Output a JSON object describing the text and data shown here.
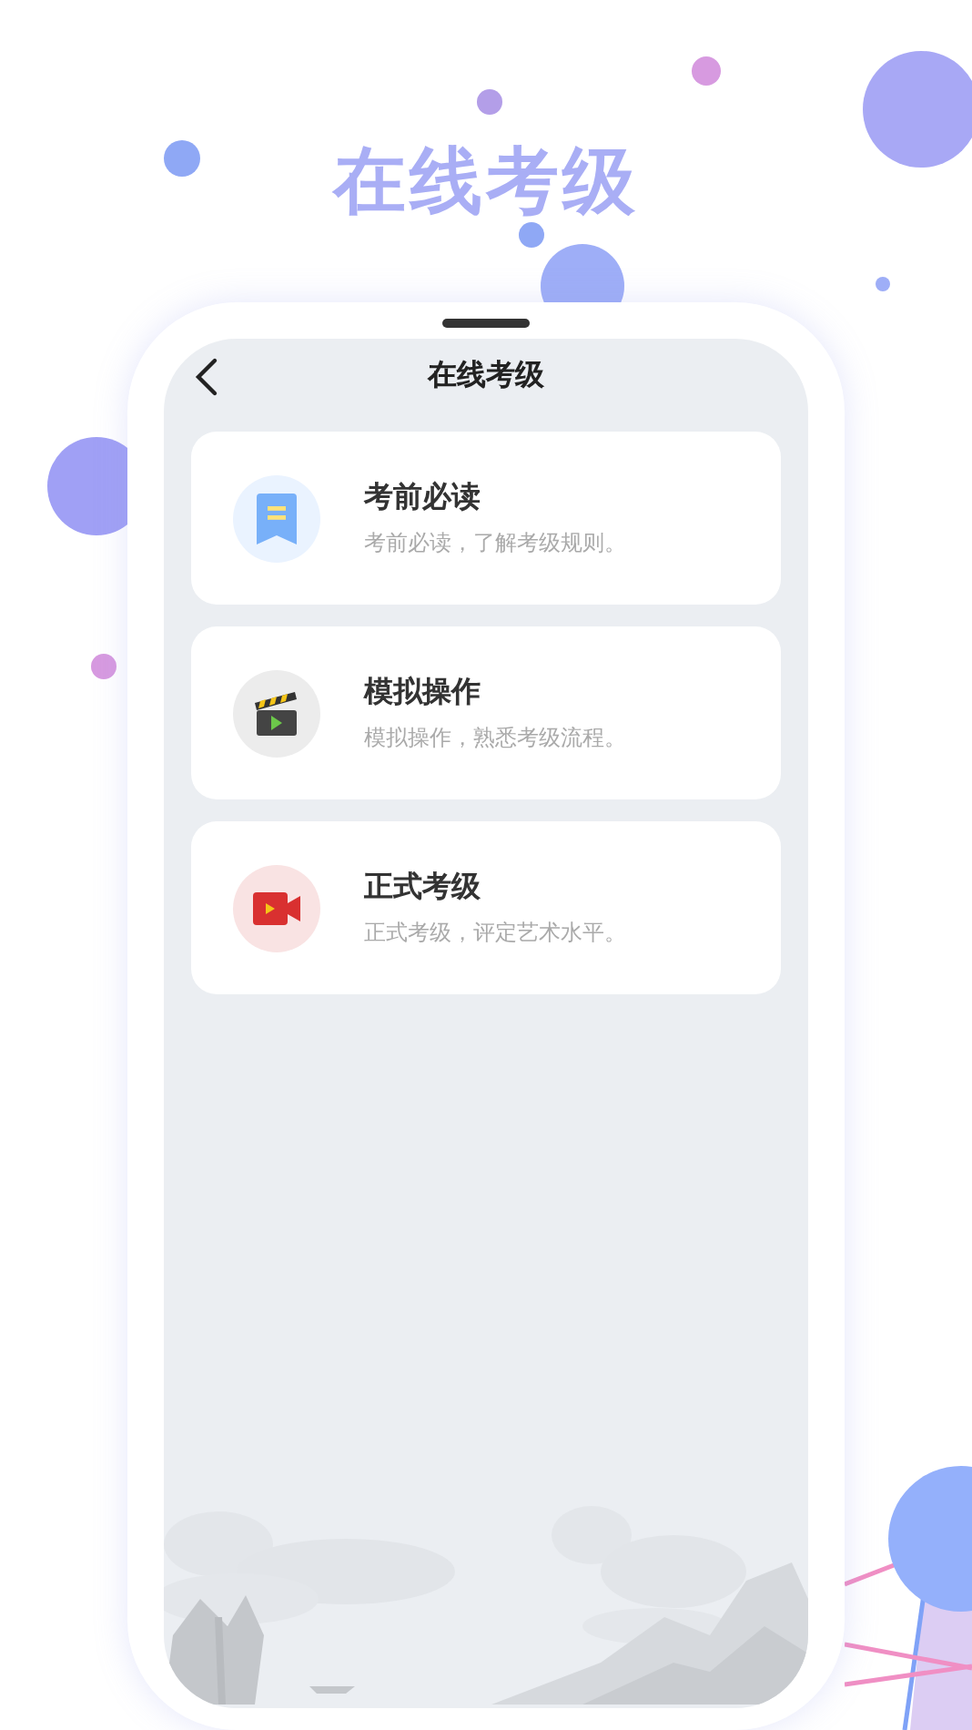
{
  "headline": "在线考级",
  "screen": {
    "title": "在线考级"
  },
  "cards": [
    {
      "kind": "bookmark",
      "title": "考前必读",
      "subtitle": "考前必读，了解考级规则。"
    },
    {
      "kind": "clapper",
      "title": "模拟操作",
      "subtitle": "模拟操作，熟悉考级流程。"
    },
    {
      "kind": "camera",
      "title": "正式考级",
      "subtitle": "正式考级，评定艺术水平。"
    }
  ]
}
